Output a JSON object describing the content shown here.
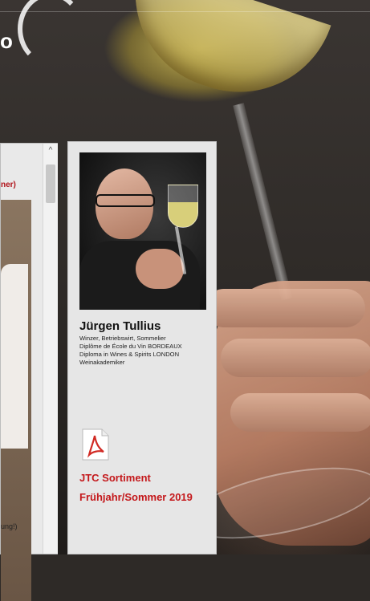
{
  "background": {
    "logo_letter": "o"
  },
  "left_panel": {
    "red_fragment": "ner)",
    "bottom_fragment": "ung!)",
    "scroll_up_glyph": "^"
  },
  "profile": {
    "name": "Jürgen Tullius",
    "credentials": [
      "Winzer, Betriebswirt, Sommelier",
      "Diplôme de École du Vin BORDEAUX",
      "Diploma in Wines & Spirits LONDON",
      "Weinakademiker"
    ],
    "document_icon": "pdf-icon",
    "link_line1": "JTC Sortiment",
    "link_line2": "Frühjahr/Sommer 2019"
  },
  "colors": {
    "accent_red": "#c4181b",
    "panel_bg": "#e6e6e6"
  }
}
